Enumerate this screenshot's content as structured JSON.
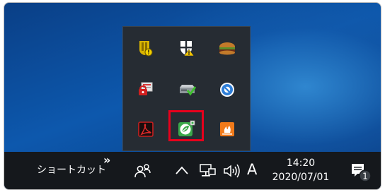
{
  "taskbar": {
    "toolbar_label": "ショートカット",
    "toolbar_chevron": "»",
    "ime_mode": "A",
    "clock_time": "14:20",
    "clock_date": "2020/07/01",
    "notification_count": "1"
  },
  "tray_flyout": {
    "icons": [
      "shield-alert-icon",
      "security-center-icon",
      "hamburger-app-icon",
      "card-reader-locked-icon",
      "drive-check-icon",
      "blue-circle-app-icon",
      "acrobat-reader-icon",
      "green-leaf-app-icon",
      "orange-flame-app-icon"
    ],
    "highlighted_icon": "green-leaf-app-icon"
  },
  "colors": {
    "highlight": "#e8001c",
    "taskbar": "#15181c",
    "flyout": "#262c33"
  }
}
